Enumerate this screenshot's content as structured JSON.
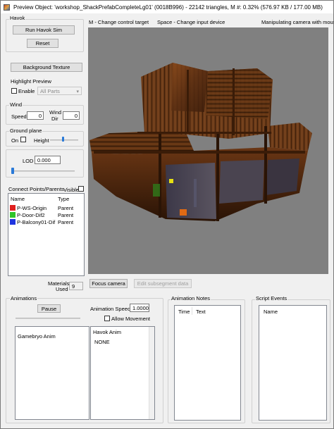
{
  "window": {
    "title": "Preview Object: 'workshop_ShackPrefabCompleteLg01' (0018B996) - 22142 triangles, M #: 0.32% (576.97 KB / 177.00 MB)"
  },
  "havok": {
    "group_label": "Havok",
    "run_label": "Run Havok Sim",
    "reset_label": "Reset"
  },
  "background_texture_label": "Background Texture",
  "highlight": {
    "label": "Highlight Preview",
    "enable_label": "Enable",
    "enabled": false,
    "parts_value": "All Parts"
  },
  "wind": {
    "label": "Wind",
    "speed_label": "Speed",
    "speed_value": "0",
    "dir_label_1": "Wind",
    "dir_label_2": "Dir",
    "dir_value": "0"
  },
  "ground_plane": {
    "label": "Ground plane",
    "on_label": "On",
    "on_checked": false,
    "height_label": "Height"
  },
  "lod": {
    "label": "LOD",
    "value": "0.000"
  },
  "connect_points": {
    "label": "Connect Points/Parents",
    "visible_label": "Visible",
    "col_name": "Name",
    "col_type": "Type",
    "rows": [
      {
        "name": "P-WS-Origin",
        "type": "Parent",
        "color": "#e0201e"
      },
      {
        "name": "P-Door-Dif2",
        "type": "Parent",
        "color": "#2fc42a"
      },
      {
        "name": "P-Balcony01-Dif",
        "type": "Parent",
        "color": "#1f35e0"
      }
    ]
  },
  "materials": {
    "label_1": "Materials",
    "label_2": "Used",
    "value": "9"
  },
  "viewport": {
    "hint_left": "M - Change control target",
    "hint_center": "Space - Change input device",
    "hint_right": "Manipulating camera with mouse"
  },
  "focus_camera_label": "Focus camera",
  "edit_subsegment_label": "Edit subsegment data",
  "animations": {
    "label": "Animations",
    "pause_label": "Pause",
    "speed_label": "Animation Speed",
    "speed_value": "1.0000",
    "allow_movement_label": "Allow Movement",
    "allow_movement_checked": false,
    "gamebryo_label": "Gamebryo Anim",
    "havok_label": "Havok Anim",
    "havok_value": "NONE"
  },
  "animation_notes": {
    "label": "Animation Notes",
    "col_time": "Time",
    "col_text": "Text"
  },
  "script_events": {
    "label": "Script Events",
    "col_name": "Name"
  }
}
